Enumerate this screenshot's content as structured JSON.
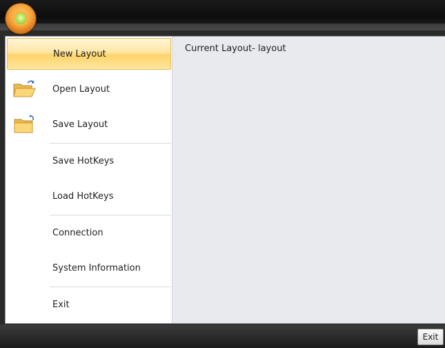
{
  "menu": {
    "items": [
      {
        "label": "New Layout",
        "icon": "none",
        "active": true
      },
      {
        "label": "Open Layout",
        "icon": "open-folder-icon"
      },
      {
        "label": "Save Layout",
        "icon": "save-folder-icon"
      },
      {
        "label": "Save HotKeys"
      },
      {
        "label": "Load HotKeys"
      },
      {
        "label": "Connection"
      },
      {
        "label": "System Information"
      },
      {
        "label": "Exit"
      }
    ]
  },
  "content": {
    "current_layout": "Current Layout- layout"
  },
  "footer": {
    "exit_label": "Exit"
  },
  "colors": {
    "highlight": "#ffd36a",
    "orb": "#f7a23a",
    "orb_center": "#8dd14a"
  }
}
